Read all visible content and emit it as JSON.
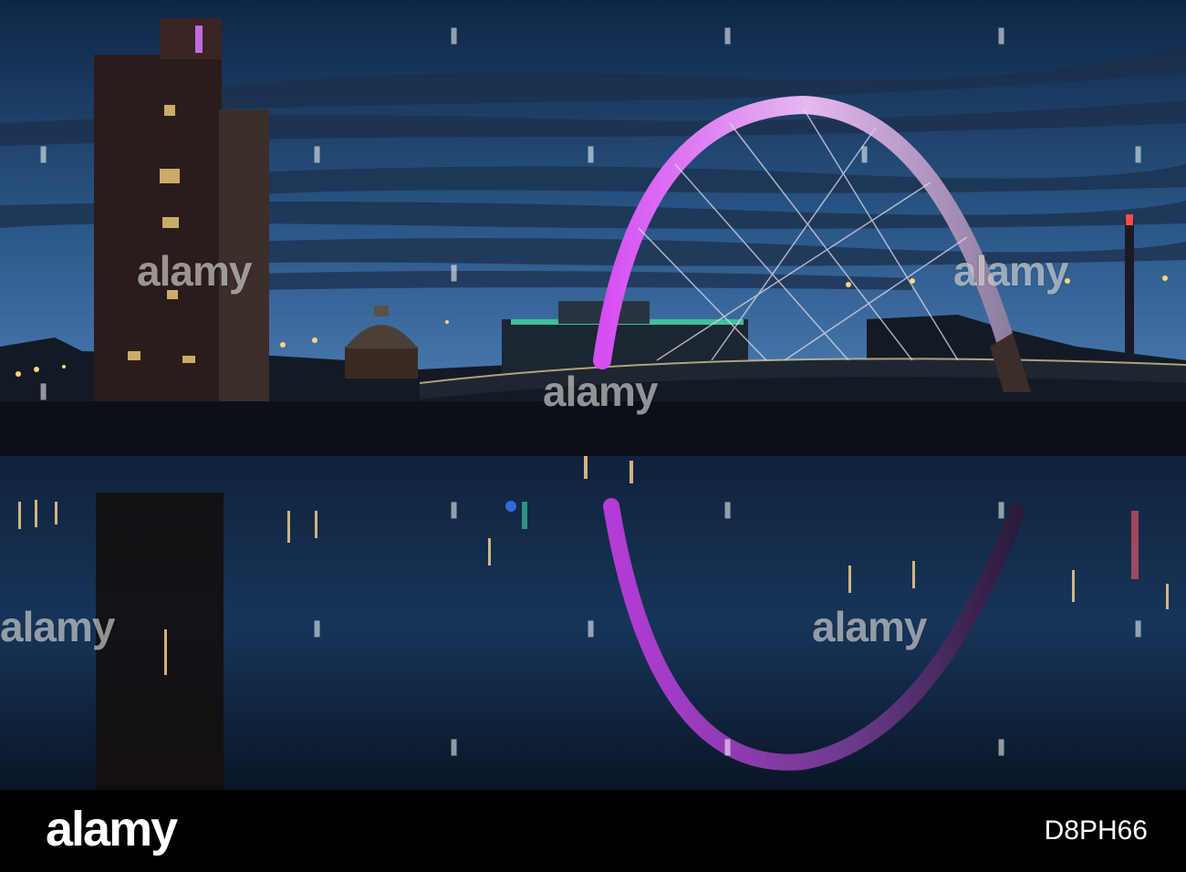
{
  "photo": {
    "watermark_text": "alamy",
    "watermark_mark": "❚"
  },
  "footer": {
    "logo": "alamy",
    "image_id": "D8PH66"
  },
  "colors": {
    "sky_top": "#0f2747",
    "sky_bottom": "#3d6fa6",
    "arch_glow": "#c83ce6",
    "water": "#0c1d33"
  }
}
